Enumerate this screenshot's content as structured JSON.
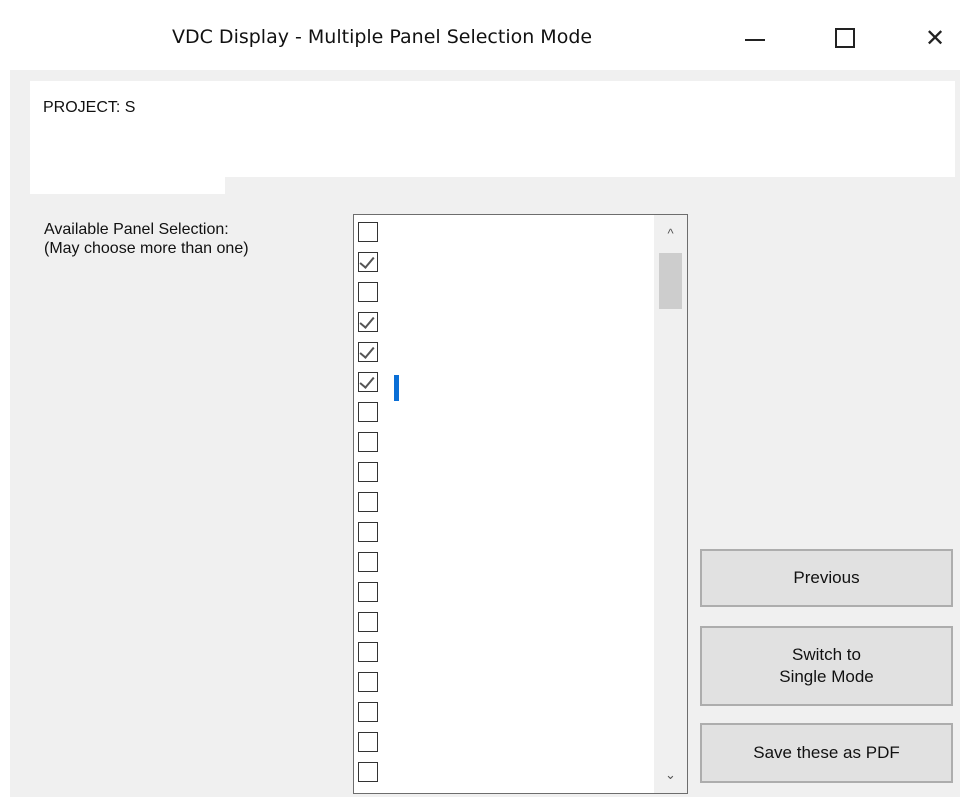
{
  "window": {
    "title": "VDC Display - Multiple Panel Selection Mode",
    "controls": {
      "minimize": "—",
      "maximize": "",
      "close": "✕"
    }
  },
  "header": {
    "project_label": "PROJECT: S"
  },
  "selection": {
    "label": "Available Panel Selection:\n(May choose more than one)",
    "items": [
      {
        "text": "",
        "checked": false
      },
      {
        "text": "",
        "checked": true
      },
      {
        "text": "",
        "checked": false
      },
      {
        "text": "",
        "checked": true
      },
      {
        "text": "",
        "checked": true
      },
      {
        "text": "",
        "checked": true,
        "selected": true
      },
      {
        "text": "",
        "checked": false
      },
      {
        "text": "",
        "checked": false
      },
      {
        "text": "",
        "checked": false
      },
      {
        "text": "",
        "checked": false
      },
      {
        "text": "",
        "checked": false
      },
      {
        "text": "",
        "checked": false
      },
      {
        "text": "",
        "checked": false
      },
      {
        "text": "",
        "checked": false
      },
      {
        "text": "",
        "checked": false
      },
      {
        "text": "",
        "checked": false
      },
      {
        "text": "",
        "checked": false
      },
      {
        "text": "",
        "checked": false
      },
      {
        "text": "",
        "checked": false
      }
    ],
    "scrollbar": {
      "up": "^",
      "down": "⌄"
    }
  },
  "buttons": {
    "previous": "Previous",
    "switch": "Switch to\nSingle Mode",
    "save_pdf": "Save these as PDF"
  },
  "colors": {
    "selection": "#0a6fd6",
    "form_background": "#f0f0f0",
    "button_face": "#e1e1e1"
  }
}
